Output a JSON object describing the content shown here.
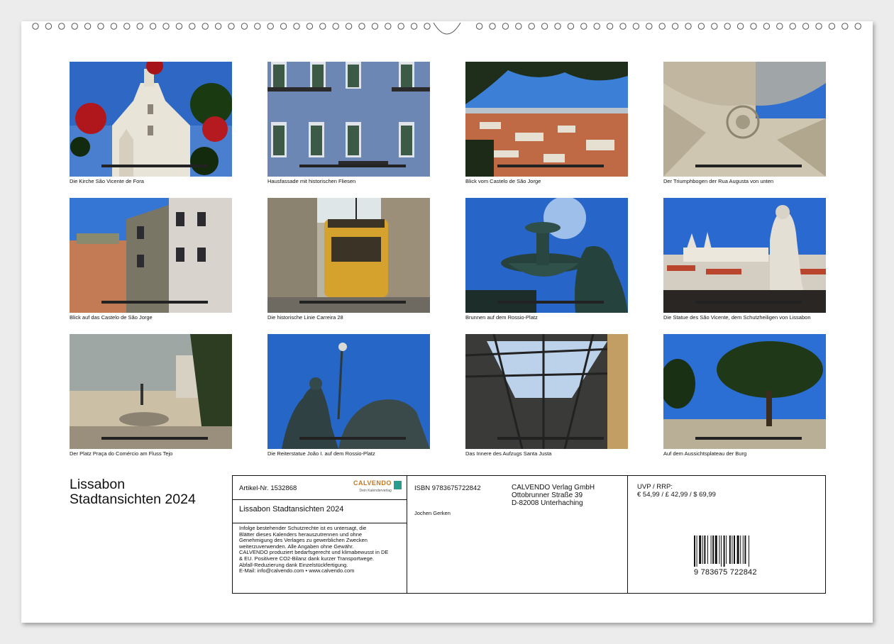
{
  "tiles": [
    {
      "caption": "Die Kirche São Vicente de Fora"
    },
    {
      "caption": "Hausfassade mit historischen Fliesen"
    },
    {
      "caption": "Blick vom Castelo de São Jorge"
    },
    {
      "caption": "Der Triumphbogen der Rua Augusta von unten"
    },
    {
      "caption": "Blick auf das Castelo de São Jorge"
    },
    {
      "caption": "Die historische Linie Carreira 28"
    },
    {
      "caption": "Brunnen auf dem Rossio-Platz"
    },
    {
      "caption": "Die Statue des São Vicente, dem Schutzheiligen von Lissabon"
    },
    {
      "caption": "Der Platz Praça do Comércio am Fluss Tejo"
    },
    {
      "caption": "Die Reiterstatue João I. auf dem Rossio-Platz"
    },
    {
      "caption": "Das Innere des Aufzugs Santa Justa"
    },
    {
      "caption": "Auf dem Aussichtsplateau der Burg"
    }
  ],
  "title": {
    "line1": "Lissabon",
    "line2": "Stadtansichten 2024"
  },
  "info": {
    "artikel": "Artikel-Nr. 1532868",
    "logo_name": "CALVENDO",
    "logo_tag": "Dein Kalenderverlag",
    "subtitle": "Lissabon Stadtansichten 2024",
    "legal": [
      "Infolge bestehender Schutzrechte ist es untersagt, die",
      "Blätter dieses Kalenders herauszutrennen und ohne",
      "Genehmigung des Verlages zu gewerblichen Zwecken",
      "weiterzuverwenden. Alle Angaben ohne Gewähr.",
      " CALVENDO produziert bedarfsgerecht und klimabewusst in DE",
      "& EU. Positivere CO2-Bilanz dank kurzer Transportwege.",
      "Abfall-Reduzierung dank Einzelstückfertigung.",
      " E-Mail: info@calvendo.com • www.calvendo.com"
    ],
    "isbn": "ISBN 9783675722842",
    "author": "Jochen Gerken",
    "publisher": [
      "CALVENDO Verlag GmbH",
      "Ottobrunner Straße 39",
      "D-82008 Unterhaching"
    ],
    "price_label": "UVP / RRP:",
    "price": "€ 54,99 / £ 42,99 / $ 69,99",
    "barcode_number": "9   783675   722842"
  },
  "colors": {
    "sky": "#2f6fc9",
    "frame": "#111111",
    "accent": "#c9761c"
  }
}
